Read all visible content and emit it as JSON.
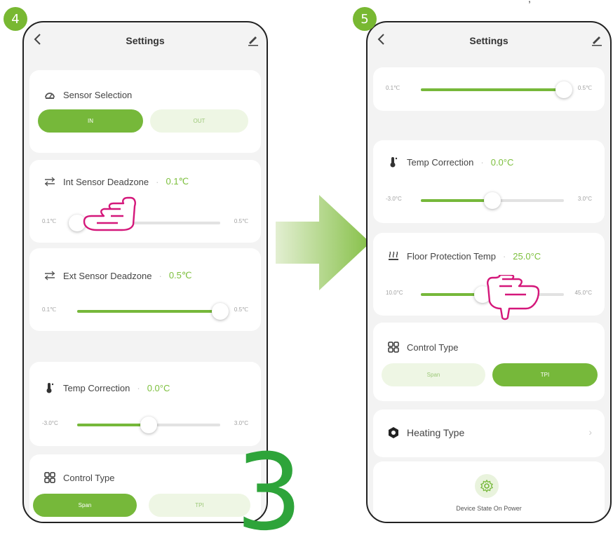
{
  "steps": {
    "left": "4",
    "right": "5"
  },
  "big_number": "3",
  "edge_mark": ",",
  "title": "Settings",
  "accent": "#76b83a",
  "left": {
    "sensor_selection": {
      "label": "Sensor Selection",
      "options": [
        "IN",
        "OUT"
      ],
      "selected": "IN"
    },
    "int_deadzone": {
      "label": "Int Sensor Deadzone",
      "value": "0.1℃",
      "min": "0.1℃",
      "max": "0.5℃",
      "level": 0.0
    },
    "ext_deadzone": {
      "label": "Ext Sensor Deadzone",
      "value": "0.5℃",
      "min": "0.1℃",
      "max": "0.5℃",
      "level": 1.0
    },
    "temp_correction": {
      "label": "Temp Correction",
      "value": "0.0°C",
      "min": "-3.0°C",
      "max": "3.0°C",
      "level": 0.5
    },
    "control_type": {
      "label": "Control Type",
      "options": [
        "Span",
        "TPI"
      ],
      "selected": "Span"
    }
  },
  "right": {
    "top_slider": {
      "min": "0.1℃",
      "max": "0.5℃",
      "level": 1.0
    },
    "temp_correction": {
      "label": "Temp Correction",
      "value": "0.0°C",
      "min": "-3.0°C",
      "max": "3.0°C",
      "level": 0.5
    },
    "floor_protection": {
      "label": "Floor Protection Temp",
      "value": "25.0°C",
      "min": "10.0°C",
      "max": "45.0°C",
      "level": 0.43
    },
    "control_type": {
      "label": "Control Type",
      "options": [
        "Span",
        "TPI"
      ],
      "selected": "TPI"
    },
    "heating_type": {
      "label": "Heating Type"
    },
    "device_state": {
      "label": "Device State On Power"
    }
  },
  "icons": [
    "back-icon",
    "edit-icon",
    "sensor-icon",
    "deadzone-icon",
    "thermometer-icon",
    "floor-heat-icon",
    "grid-icon",
    "heating-type-icon",
    "gear-icon",
    "hand-pointer-icon",
    "arrow-right-icon"
  ]
}
